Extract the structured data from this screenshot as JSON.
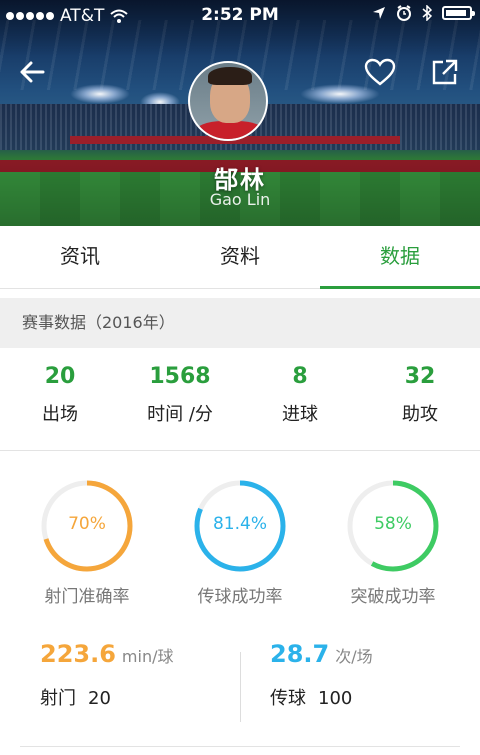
{
  "status_bar": {
    "carrier": "AT&T",
    "time": "2:52 PM"
  },
  "player": {
    "name_cn": "郜林",
    "name_en": "Gao Lin"
  },
  "tabs": [
    {
      "label": "资讯",
      "active": false
    },
    {
      "label": "资料",
      "active": false
    },
    {
      "label": "数据",
      "active": true
    }
  ],
  "section": {
    "title": "赛事数据（2016年）"
  },
  "stats": [
    {
      "value": "20",
      "label": "出场"
    },
    {
      "value": "1568",
      "label": "时间 /分"
    },
    {
      "value": "8",
      "label": "进球"
    },
    {
      "value": "32",
      "label": "助攻"
    }
  ],
  "rings": [
    {
      "percent_text": "70%",
      "value": 0.7,
      "label": "射门准确率",
      "color": "#f5a63b"
    },
    {
      "percent_text": "81.4%",
      "value": 0.814,
      "label": "传球成功率",
      "color": "#2bb2ea"
    },
    {
      "percent_text": "58%",
      "value": 0.58,
      "label": "突破成功率",
      "color": "#3ecb63"
    }
  ],
  "shots": {
    "big_value": "223.6",
    "unit": "min/球",
    "label": "射门",
    "count": "20",
    "color": "#f5a63b"
  },
  "passes": {
    "big_value": "28.7",
    "unit": "次/场",
    "label": "传球",
    "count": "100",
    "color": "#2bb2ea"
  },
  "colors": {
    "accent": "#2a9e3d",
    "ring_track": "#eeeeee"
  }
}
